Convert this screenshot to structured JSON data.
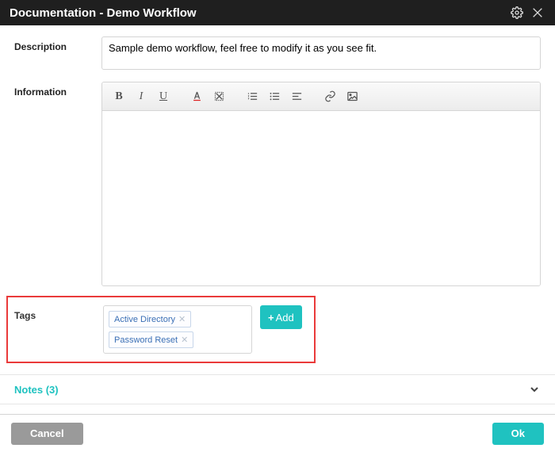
{
  "header": {
    "title": "Documentation - Demo Workflow"
  },
  "form": {
    "description_label": "Description",
    "description_value": "Sample demo workflow, feel free to modify it as you see fit.",
    "information_label": "Information",
    "tags_label": "Tags",
    "tags": [
      "Active Directory",
      "Password Reset"
    ],
    "add_button": "Add"
  },
  "notes": {
    "label": "Notes (3)"
  },
  "footer": {
    "cancel": "Cancel",
    "ok": "Ok"
  }
}
